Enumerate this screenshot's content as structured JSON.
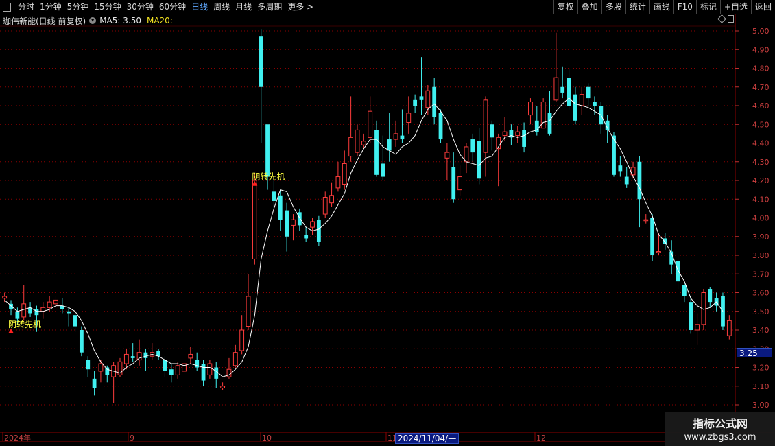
{
  "toolbar": {
    "periods": [
      "分时",
      "1分钟",
      "5分钟",
      "15分钟",
      "30分钟",
      "60分钟",
      "日线",
      "周线",
      "月线",
      "多周期",
      "更多 >"
    ],
    "active_period": "日线",
    "actions": [
      "复权",
      "叠加",
      "多股",
      "统计",
      "画线",
      "F10",
      "标记",
      "+自选",
      "返回"
    ]
  },
  "info": {
    "title": "珈伟新能(日线 前复权)",
    "ma5_label": "MA5: 3.50",
    "ma20_label": "MA20:"
  },
  "axis": {
    "price_ticks": [
      "5.00",
      "4.90",
      "4.80",
      "4.70",
      "4.60",
      "4.50",
      "4.40",
      "4.30",
      "4.20",
      "4.10",
      "4.00",
      "3.90",
      "3.80",
      "3.70",
      "3.60",
      "3.50",
      "3.40",
      "3.30",
      "3.20",
      "3.10",
      "3.00"
    ],
    "current_price": "3.25",
    "time_labels": [
      "2024年",
      "9",
      "10",
      "11",
      "12"
    ],
    "cursor_date": "2024/11/04/—"
  },
  "signal_text": "阴转先机",
  "watermark": {
    "line1": "指标公式网",
    "line2": "www.zbgs3.com"
  },
  "colors": {
    "up": "#ff3c3c",
    "down": "#40f0f0",
    "ma": "#ffffff",
    "grid": "#8b0000",
    "signal": "#ffff40"
  },
  "chart_data": {
    "type": "candlestick",
    "ylim": [
      3.0,
      5.0
    ],
    "x_labels": [
      "2024年",
      "9",
      "10",
      "11",
      "12"
    ],
    "candles": [
      [
        3.57,
        3.58,
        3.6,
        3.55
      ],
      [
        3.54,
        3.51,
        3.56,
        3.48
      ],
      [
        3.5,
        3.46,
        3.52,
        3.43
      ],
      [
        3.47,
        3.54,
        3.64,
        3.45
      ],
      [
        3.52,
        3.49,
        3.55,
        3.47
      ],
      [
        3.51,
        3.48,
        3.53,
        3.39
      ],
      [
        3.5,
        3.52,
        3.55,
        3.46
      ],
      [
        3.52,
        3.55,
        3.58,
        3.5
      ],
      [
        3.54,
        3.56,
        3.58,
        3.52
      ],
      [
        3.53,
        3.51,
        3.57,
        3.49
      ],
      [
        3.5,
        3.49,
        3.52,
        3.42
      ],
      [
        3.48,
        3.42,
        3.5,
        3.39
      ],
      [
        3.4,
        3.28,
        3.42,
        3.26
      ],
      [
        3.24,
        3.19,
        3.26,
        3.15
      ],
      [
        3.14,
        3.09,
        3.18,
        3.05
      ],
      [
        3.18,
        3.22,
        3.24,
        3.12
      ],
      [
        3.2,
        3.16,
        3.21,
        3.12
      ],
      [
        3.15,
        3.21,
        3.23,
        3.01
      ],
      [
        3.16,
        3.23,
        3.25,
        3.15
      ],
      [
        3.22,
        3.27,
        3.3,
        3.19
      ],
      [
        3.26,
        3.25,
        3.33,
        3.23
      ],
      [
        3.24,
        3.28,
        3.35,
        3.21
      ],
      [
        3.28,
        3.25,
        3.3,
        3.18
      ],
      [
        3.26,
        3.28,
        3.33,
        3.24
      ],
      [
        3.29,
        3.26,
        3.3,
        3.24
      ],
      [
        3.24,
        3.18,
        3.26,
        3.15
      ],
      [
        3.19,
        3.16,
        3.22,
        3.12
      ],
      [
        3.16,
        3.21,
        3.23,
        3.14
      ],
      [
        3.18,
        3.22,
        3.24,
        3.17
      ],
      [
        3.25,
        3.27,
        3.31,
        3.22
      ],
      [
        3.24,
        3.2,
        3.28,
        3.18
      ],
      [
        3.22,
        3.13,
        3.24,
        3.1
      ],
      [
        3.16,
        3.22,
        3.24,
        3.14
      ],
      [
        3.2,
        3.14,
        3.23,
        3.09
      ],
      [
        3.09,
        3.1,
        3.12,
        3.08
      ],
      [
        3.15,
        3.19,
        3.25,
        3.14
      ],
      [
        3.21,
        3.28,
        3.32,
        3.2
      ],
      [
        3.29,
        3.4,
        3.48,
        3.27
      ],
      [
        3.42,
        3.58,
        3.7,
        3.4
      ],
      [
        3.78,
        4.2,
        4.24,
        3.75
      ],
      [
        4.97,
        4.7,
        5.01,
        4.4
      ],
      [
        4.5,
        4.22,
        4.3,
        4.15
      ],
      [
        4.14,
        4.09,
        4.22,
        4.05
      ],
      [
        4.12,
        3.99,
        4.15,
        3.93
      ],
      [
        4.04,
        3.9,
        4.08,
        3.82
      ],
      [
        3.96,
        3.99,
        4.02,
        3.88
      ],
      [
        4.03,
        3.96,
        4.05,
        3.93
      ],
      [
        3.91,
        3.89,
        3.95,
        3.87
      ],
      [
        3.95,
        3.98,
        4.0,
        3.91
      ],
      [
        3.99,
        3.87,
        4.01,
        3.85
      ],
      [
        4.02,
        4.11,
        4.14,
        4.0
      ],
      [
        4.08,
        4.12,
        4.19,
        4.06
      ],
      [
        4.16,
        4.22,
        4.3,
        4.14
      ],
      [
        4.18,
        4.29,
        4.36,
        4.15
      ],
      [
        4.33,
        4.43,
        4.65,
        4.3
      ],
      [
        4.35,
        4.47,
        4.5,
        4.33
      ],
      [
        4.39,
        4.41,
        4.45,
        4.37
      ],
      [
        4.43,
        4.57,
        4.65,
        4.4
      ],
      [
        4.47,
        4.23,
        4.52,
        4.22
      ],
      [
        4.29,
        4.22,
        4.44,
        4.2
      ],
      [
        4.42,
        4.36,
        4.56,
        4.3
      ],
      [
        4.42,
        4.45,
        4.52,
        4.38
      ],
      [
        4.44,
        4.42,
        4.58,
        4.4
      ],
      [
        4.51,
        4.56,
        4.65,
        4.45
      ],
      [
        4.63,
        4.6,
        4.66,
        4.56
      ],
      [
        4.65,
        4.63,
        4.86,
        4.55
      ],
      [
        4.59,
        4.68,
        4.71,
        4.55
      ],
      [
        4.7,
        4.54,
        4.75,
        4.5
      ],
      [
        4.56,
        4.42,
        4.58,
        4.4
      ],
      [
        4.32,
        4.35,
        4.4,
        4.2
      ],
      [
        4.27,
        4.1,
        4.35,
        4.08
      ],
      [
        4.15,
        4.22,
        4.28,
        4.12
      ],
      [
        4.3,
        4.38,
        4.4,
        4.24
      ],
      [
        4.42,
        4.35,
        4.45,
        4.3
      ],
      [
        4.41,
        4.21,
        4.48,
        4.18
      ],
      [
        4.35,
        4.63,
        4.65,
        4.22
      ],
      [
        4.5,
        4.43,
        4.52,
        4.36
      ],
      [
        4.37,
        4.43,
        4.45,
        4.17
      ],
      [
        4.44,
        4.46,
        4.54,
        4.41
      ],
      [
        4.47,
        4.43,
        4.5,
        4.39
      ],
      [
        4.44,
        4.46,
        4.49,
        4.4
      ],
      [
        4.47,
        4.38,
        4.51,
        4.35
      ],
      [
        4.55,
        4.62,
        4.64,
        4.5
      ],
      [
        4.52,
        4.46,
        4.6,
        4.44
      ],
      [
        4.48,
        4.62,
        4.64,
        4.48
      ],
      [
        4.56,
        4.45,
        4.68,
        4.44
      ],
      [
        4.63,
        4.75,
        4.99,
        4.62
      ],
      [
        4.7,
        4.67,
        4.81,
        4.64
      ],
      [
        4.75,
        4.6,
        4.8,
        4.58
      ],
      [
        4.66,
        4.52,
        4.7,
        4.5
      ],
      [
        4.6,
        4.66,
        4.7,
        4.55
      ],
      [
        4.7,
        4.64,
        4.72,
        4.6
      ],
      [
        4.62,
        4.6,
        4.65,
        4.55
      ],
      [
        4.6,
        4.5,
        4.62,
        4.45
      ],
      [
        4.52,
        4.47,
        4.55,
        4.4
      ],
      [
        4.44,
        4.23,
        4.46,
        4.22
      ],
      [
        4.28,
        4.25,
        4.33,
        4.22
      ],
      [
        4.22,
        4.18,
        4.27,
        4.16
      ],
      [
        4.23,
        4.27,
        4.3,
        4.21
      ],
      [
        4.3,
        4.1,
        4.33,
        3.95
      ],
      [
        3.99,
        3.99,
        4.02,
        3.97
      ],
      [
        4.0,
        3.8,
        4.02,
        3.77
      ],
      [
        3.82,
        3.82,
        3.92,
        3.8
      ],
      [
        3.89,
        3.86,
        3.92,
        3.83
      ],
      [
        3.82,
        3.75,
        3.88,
        3.7
      ],
      [
        3.77,
        3.66,
        3.8,
        3.62
      ],
      [
        3.64,
        3.58,
        3.66,
        3.55
      ],
      [
        3.55,
        3.4,
        3.58,
        3.38
      ],
      [
        3.4,
        3.43,
        3.49,
        3.32
      ],
      [
        3.43,
        3.6,
        3.62,
        3.4
      ],
      [
        3.62,
        3.55,
        3.63,
        3.52
      ],
      [
        3.57,
        3.53,
        3.6,
        3.5
      ],
      [
        3.58,
        3.42,
        3.6,
        3.4
      ],
      [
        3.37,
        3.45,
        3.48,
        3.35
      ]
    ],
    "ma5": [
      3.56,
      3.53,
      3.5,
      3.51,
      3.52,
      3.5,
      3.5,
      3.51,
      3.53,
      3.53,
      3.52,
      3.5,
      3.45,
      3.38,
      3.29,
      3.23,
      3.19,
      3.18,
      3.17,
      3.2,
      3.22,
      3.25,
      3.26,
      3.27,
      3.26,
      3.24,
      3.22,
      3.22,
      3.21,
      3.22,
      3.21,
      3.2,
      3.2,
      3.18,
      3.15,
      3.16,
      3.19,
      3.23,
      3.31,
      3.48,
      3.78,
      3.93,
      4.05,
      4.15,
      4.14,
      4.06,
      4.0,
      3.95,
      3.93,
      3.94,
      3.97,
      4.01,
      4.07,
      4.13,
      4.24,
      4.31,
      4.37,
      4.42,
      4.42,
      4.38,
      4.36,
      4.34,
      4.38,
      4.4,
      4.44,
      4.52,
      4.58,
      4.61,
      4.57,
      4.52,
      4.42,
      4.34,
      4.3,
      4.29,
      4.28,
      4.32,
      4.33,
      4.38,
      4.43,
      4.44,
      4.43,
      4.44,
      4.46,
      4.47,
      4.51,
      4.52,
      4.57,
      4.61,
      4.64,
      4.61,
      4.6,
      4.59,
      4.57,
      4.55,
      4.48,
      4.42,
      4.37,
      4.3,
      4.22,
      4.16,
      4.08,
      4.01,
      3.91,
      3.87,
      3.81,
      3.72,
      3.66,
      3.57,
      3.53,
      3.51,
      3.52,
      3.55,
      3.5
    ]
  }
}
